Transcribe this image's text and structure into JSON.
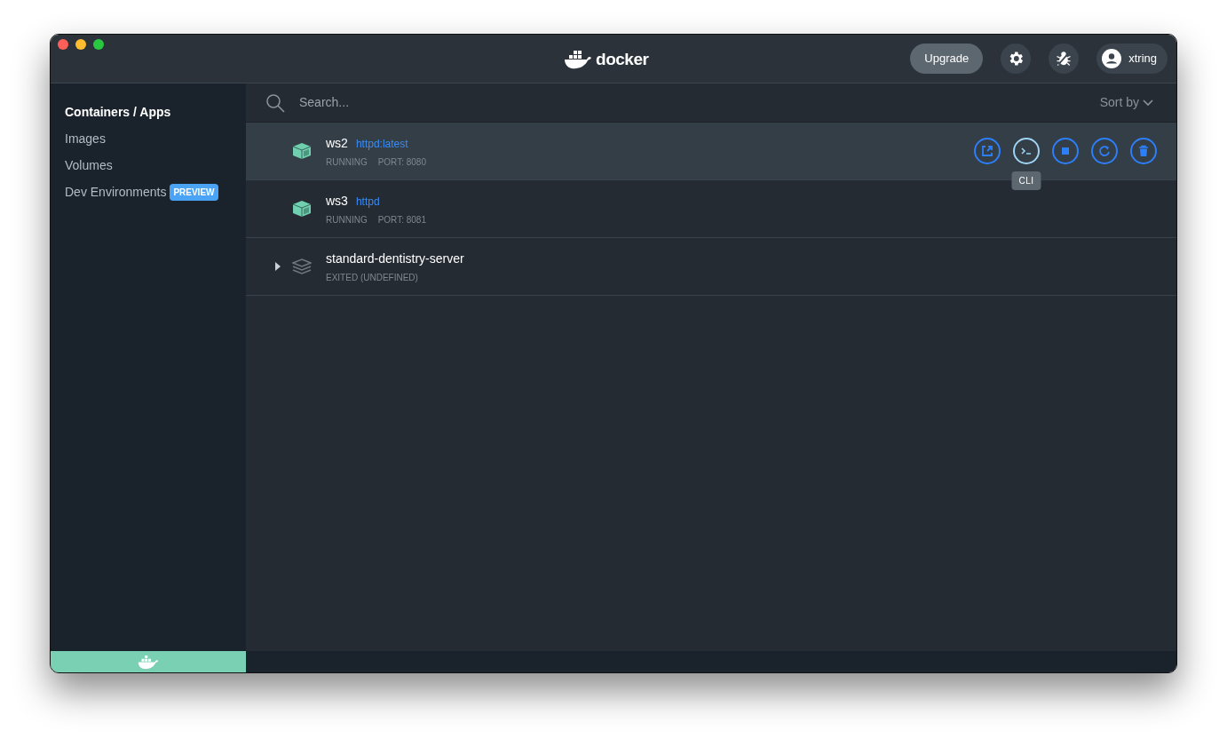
{
  "header": {
    "logo_text": "docker",
    "upgrade": "Upgrade",
    "user": "xtring"
  },
  "sidebar": {
    "items": [
      {
        "label": "Containers / Apps",
        "selected": true
      },
      {
        "label": "Images",
        "selected": false
      },
      {
        "label": "Volumes",
        "selected": false
      },
      {
        "label": "Dev Environments",
        "selected": false,
        "badge": "PREVIEW"
      }
    ]
  },
  "search": {
    "placeholder": "Search...",
    "sort": "Sort by"
  },
  "rows": [
    {
      "kind": "container",
      "name": "ws2",
      "image": "httpd:latest",
      "status": "RUNNING",
      "port": "PORT: 8080",
      "selected": true,
      "tooltip": "CLI"
    },
    {
      "kind": "container",
      "name": "ws3",
      "image": "httpd",
      "status": "RUNNING",
      "port": "PORT: 8081",
      "selected": false
    },
    {
      "kind": "app",
      "name": "standard-dentistry-server",
      "status": "EXITED (UNDEFINED)",
      "expanded": false,
      "selected": false
    }
  ]
}
